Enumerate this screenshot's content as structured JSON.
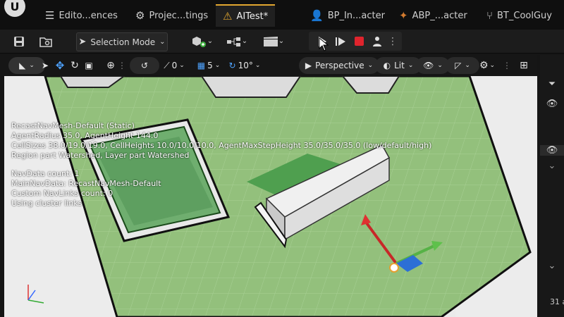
{
  "tabs": [
    {
      "label": "Edito...ences",
      "icon": "sliders-icon"
    },
    {
      "label": "Projec...tings",
      "icon": "project-settings-icon"
    },
    {
      "label": "AITest*",
      "icon": "level-icon"
    },
    {
      "label": "BP_In...acter",
      "icon": "blueprint-person-icon"
    },
    {
      "label": "ABP_...acter",
      "icon": "anim-blueprint-icon"
    },
    {
      "label": "BT_CoolGuy",
      "icon": "behavior-tree-icon"
    }
  ],
  "toolbar": {
    "selection_mode": "Selection Mode"
  },
  "viewport_toolbar": {
    "rotate_snap_value": "0",
    "grid_snap_value": "5",
    "angle_snap_value": "10°",
    "perspective_label": "Perspective",
    "lit_label": "Lit"
  },
  "viewport": {
    "stats": [
      "RecastNavMesh-Default (Static)",
      "AgentRadius 35.0, AgentHeight 144.0",
      "CellSizes 38.0/19.0/19.0, CellHeights 10.0/10.0/10.0, AgentMaxStepHeight 35.0/35.0/35.0 (low/default/high)",
      "Region part Watershed, Layer part Watershed",
      "",
      "NavData count: 1",
      "MainNavData: RecastNavMesh-Default",
      "Custom NavLinks count: 0",
      "Using cluster links"
    ]
  },
  "right_panel": {
    "count_text": "31 a"
  },
  "colors": {
    "active_tab_accent": "#e2a72f",
    "stop_button": "#e0242d",
    "navmesh_green": "#8fbf73"
  }
}
